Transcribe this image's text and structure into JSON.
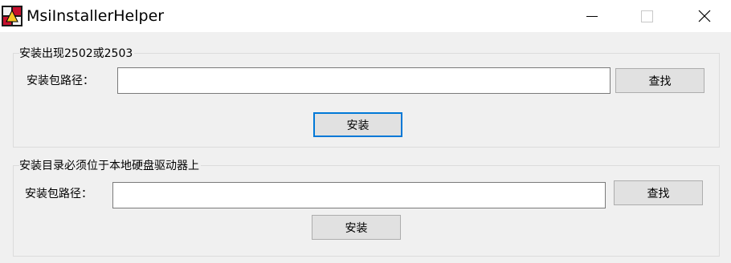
{
  "window": {
    "title": "MsiInstallerHelper",
    "icon": "msi-installer-app-icon",
    "controls": [
      "minimize-icon",
      "maximize-icon",
      "close-icon"
    ]
  },
  "group1": {
    "legend": "安装出现2502或2503",
    "path_label": "安装包路径：",
    "path_value": "",
    "browse_label": "查找",
    "install_label": "安装"
  },
  "group2": {
    "legend": "安装目录必须位于本地硬盘驱动器上",
    "path_label": "安装包路径：",
    "path_value": "",
    "browse_label": "查找",
    "install_label": "安装"
  },
  "colors": {
    "window_bg": "#f0f0f0",
    "titlebar_bg": "#ffffff",
    "focus_accent": "#0078d7",
    "button_face": "#e1e1e1"
  }
}
